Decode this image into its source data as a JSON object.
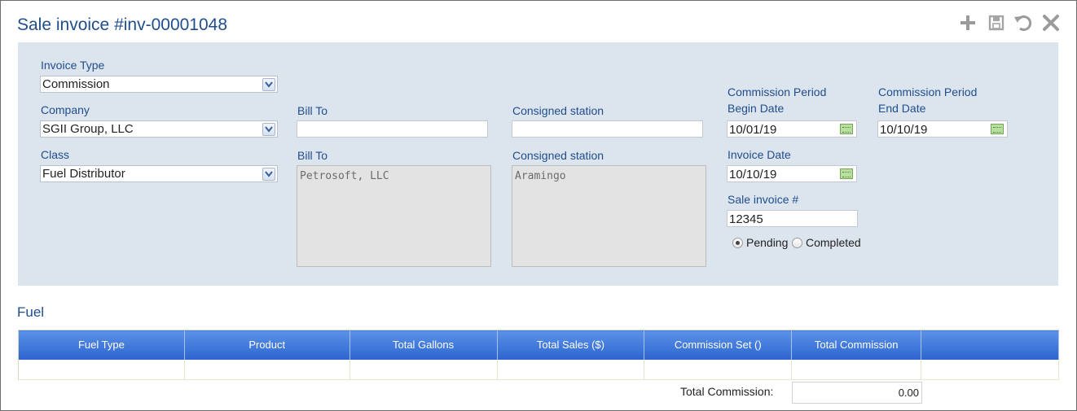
{
  "title": "Sale invoice #inv-00001048",
  "toolbar": {
    "icons": [
      "plus-icon",
      "save-icon",
      "undo-icon",
      "close-icon"
    ]
  },
  "form": {
    "invoice_type": {
      "label": "Invoice Type",
      "value": "Commission"
    },
    "company": {
      "label": "Company",
      "value": "SGII Group, LLC"
    },
    "class": {
      "label": "Class",
      "value": "Fuel Distributor"
    },
    "bill_to_search": {
      "label": "Bill To",
      "value": ""
    },
    "bill_to_detail": {
      "label": "Bill To",
      "value": "Petrosoft, LLC"
    },
    "consigned_search": {
      "label": "Consigned station",
      "value": ""
    },
    "consigned_detail": {
      "label": "Consigned station",
      "value": "Aramingo"
    },
    "period_begin": {
      "label_line1": "Commission Period",
      "label_line2": "Begin Date",
      "value": "10/01/19"
    },
    "period_end": {
      "label_line1": "Commission Period",
      "label_line2": "End Date",
      "value": "10/10/19"
    },
    "invoice_date": {
      "label": "Invoice Date",
      "value": "10/10/19"
    },
    "sale_invoice_no": {
      "label": "Sale invoice #",
      "value": "12345"
    },
    "status": {
      "pending_label": "Pending",
      "completed_label": "Completed",
      "selected": "Pending"
    }
  },
  "fuel": {
    "section_title": "Fuel",
    "columns": [
      "Fuel Type",
      "Product",
      "Total Gallons",
      "Total Sales ($)",
      "Commission Set ()",
      "Total Commission",
      ""
    ],
    "total_label": "Total Commission:",
    "total_value": "0.00"
  },
  "colors": {
    "accent_text": "#1f4e8c",
    "panel_bg": "#dce4ee",
    "header_blue": "#2c64cf"
  }
}
